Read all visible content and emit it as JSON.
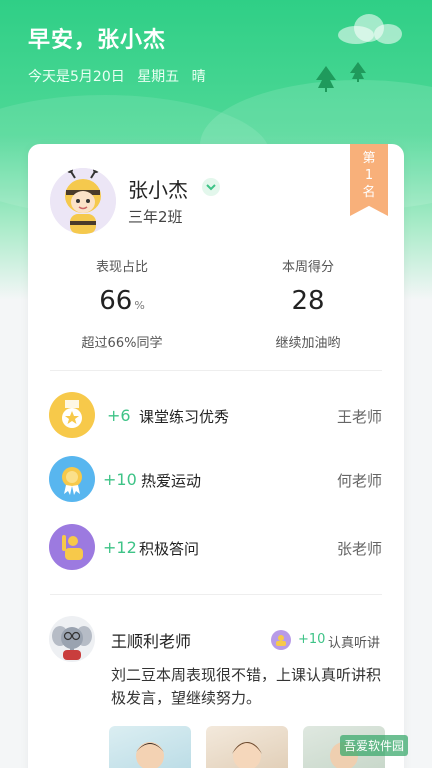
{
  "header": {
    "greeting": "早安，张小杰",
    "date": "今天是5月20日",
    "weekday": "星期五",
    "weather": "晴"
  },
  "student": {
    "name": "张小杰",
    "class": "三年2班",
    "rank_label": "第1名"
  },
  "stats": {
    "performance_label": "表现占比",
    "performance_value": "66",
    "performance_unit": "%",
    "performance_sub": "超过66%同学",
    "weekly_label": "本周得分",
    "weekly_value": "28",
    "weekly_sub": "继续加油哟"
  },
  "awards": [
    {
      "points": "+6",
      "title": "课堂练习优秀",
      "teacher": "王老师",
      "icon": "medal-icon"
    },
    {
      "points": "+10",
      "title": "热爱运动",
      "teacher": "何老师",
      "icon": "sports-award-icon"
    },
    {
      "points": "+12",
      "title": "积极答问",
      "teacher": "张老师",
      "icon": "raise-hand-icon"
    }
  ],
  "comment": {
    "teacher": "王顺利老师",
    "points": "+10",
    "tag": "认真听讲",
    "text": "刘二豆本周表现很不错，上课认真听讲积极发言，望继续努力。"
  },
  "watermark": "吾爱软件园",
  "colors": {
    "brand_green": "#2fcf86",
    "points_green": "#3ec387",
    "rank_orange": "#f8b07a",
    "medal_yellow": "#f7c94a",
    "sports_blue": "#58b6ef",
    "hand_purple": "#9c7ae0"
  }
}
